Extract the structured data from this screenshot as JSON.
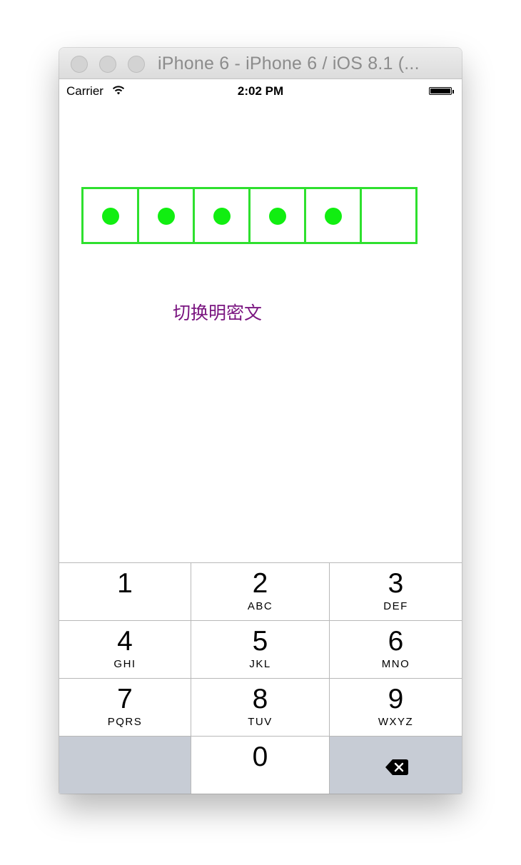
{
  "window": {
    "title": "iPhone 6 - iPhone 6 / iOS 8.1 (..."
  },
  "status_bar": {
    "carrier": "Carrier",
    "time": "2:02 PM",
    "wifi_icon": "wifi-icon",
    "battery_icon": "battery-icon"
  },
  "pin": {
    "length": 6,
    "filled": 5,
    "border_color": "#2ee02e",
    "dot_color": "#11ee11"
  },
  "toggle_label": "切换明密文",
  "toggle_color": "#7a1580",
  "keypad": {
    "keys": [
      {
        "num": "1",
        "letters": ""
      },
      {
        "num": "2",
        "letters": "ABC"
      },
      {
        "num": "3",
        "letters": "DEF"
      },
      {
        "num": "4",
        "letters": "GHI"
      },
      {
        "num": "5",
        "letters": "JKL"
      },
      {
        "num": "6",
        "letters": "MNO"
      },
      {
        "num": "7",
        "letters": "PQRS"
      },
      {
        "num": "8",
        "letters": "TUV"
      },
      {
        "num": "9",
        "letters": "WXYZ"
      },
      {
        "num": "0",
        "letters": ""
      }
    ],
    "delete_icon": "backspace-icon"
  }
}
